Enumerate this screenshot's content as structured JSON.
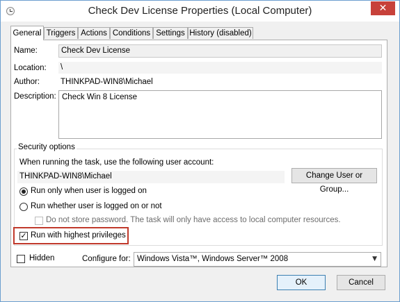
{
  "window": {
    "title": "Check Dev License Properties (Local Computer)",
    "close_glyph": "✕"
  },
  "tabs": [
    {
      "label": "General",
      "active": true
    },
    {
      "label": "Triggers"
    },
    {
      "label": "Actions"
    },
    {
      "label": "Conditions"
    },
    {
      "label": "Settings"
    },
    {
      "label": "History (disabled)"
    }
  ],
  "general": {
    "name_label": "Name:",
    "name_value": "Check Dev License",
    "location_label": "Location:",
    "location_value": "\\",
    "author_label": "Author:",
    "author_value": "THINKPAD-WIN8\\Michael",
    "description_label": "Description:",
    "description_value": "Check Win 8 License"
  },
  "security": {
    "group_title": "Security options",
    "account_prompt": "When running the task, use the following user account:",
    "account_value": "THINKPAD-WIN8\\Michael",
    "change_user_button": "Change User or Group...",
    "radio_logged_on": "Run only when user is logged on",
    "radio_whether": "Run whether user is logged on or not",
    "no_store_password": "Do not store password.  The task will only have access to local computer resources.",
    "highest_privileges": "Run with highest privileges",
    "highest_checked": true
  },
  "footer": {
    "hidden_label": "Hidden",
    "configure_label": "Configure for:",
    "configure_value": "Windows Vista™, Windows Server™ 2008"
  },
  "buttons": {
    "ok": "OK",
    "cancel": "Cancel"
  },
  "colors": {
    "highlight_border": "#c0392b",
    "close_button": "#c7413a"
  }
}
